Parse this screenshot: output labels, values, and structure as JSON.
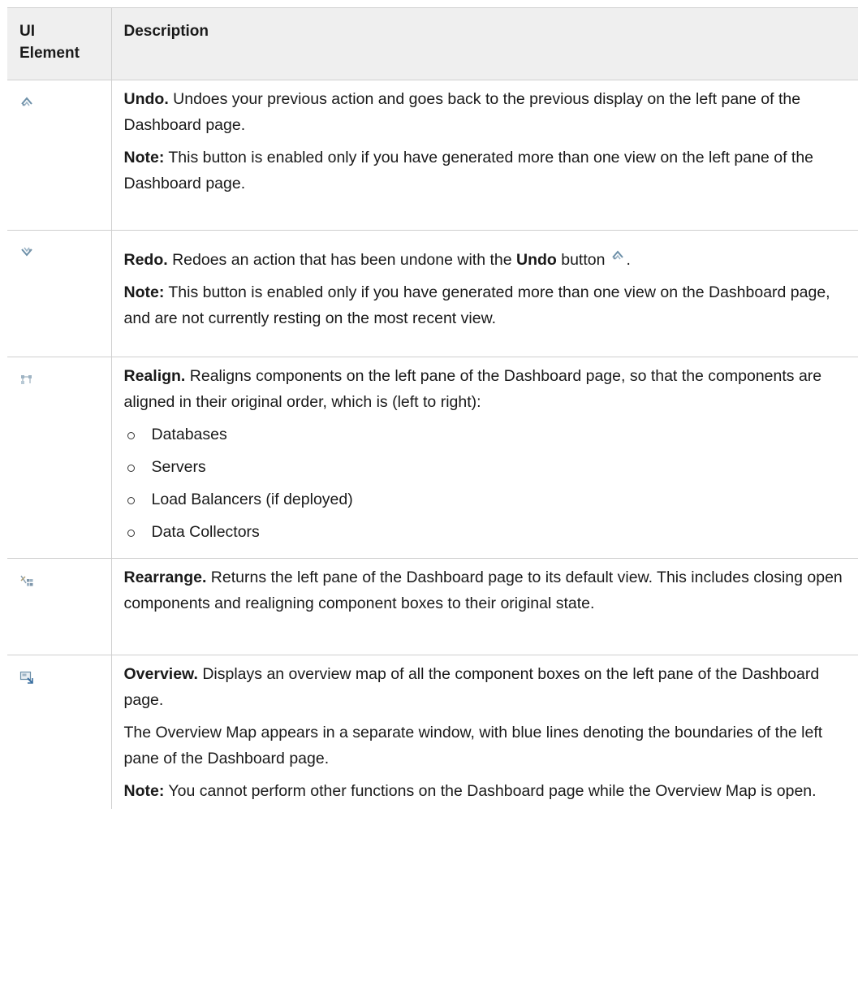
{
  "table": {
    "header": {
      "ui_element": "UI Element",
      "description": "Description"
    },
    "rows": [
      {
        "icon": "undo-icon",
        "name": "Undo.",
        "text": " Undoes your previous action and goes back to the previous display on the left pane of the Dashboard page.",
        "note_label": "Note:",
        "note_text": " This button is enabled only if you have generated more than one view on the left pane of the Dashboard page."
      },
      {
        "icon": "redo-icon",
        "name": "Redo.",
        "text_before": " Redoes an action that has been undone with the ",
        "text_bold": "Undo",
        "text_after": " button",
        "text_end": ".",
        "inline_icon": "undo-icon",
        "note_label": "Note:",
        "note_text": " This button is enabled only if you have generated more than one view on the Dashboard page, and are not currently resting on the most recent view."
      },
      {
        "icon": "realign-icon",
        "name": "Realign.",
        "text": " Realigns components on the left pane of the Dashboard page, so that the components are aligned in their original order, which is (left to right):",
        "list": [
          "Databases",
          "Servers",
          "Load Balancers (if deployed)",
          "Data Collectors"
        ]
      },
      {
        "icon": "rearrange-icon",
        "name": "Rearrange.",
        "text": " Returns the left pane of the Dashboard page to its default view. This includes closing open components and realigning component boxes to their original state."
      },
      {
        "icon": "overview-icon",
        "name": "Overview.",
        "text": " Displays an overview map of all the component boxes on the left pane of the Dashboard page.",
        "para2": "The Overview Map appears in a separate window, with blue lines denoting the boundaries of the left pane of the Dashboard page.",
        "note_label": "Note:",
        "note_text": " You cannot perform other functions on the Dashboard page while the Overview Map is open."
      }
    ]
  }
}
